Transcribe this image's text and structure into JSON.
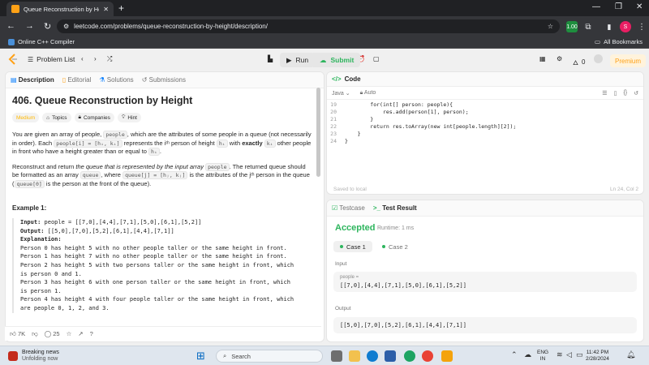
{
  "browser": {
    "tab_title": "Queue Reconstruction by Heigh",
    "url": "leetcode.com/problems/queue-reconstruction-by-height/description/",
    "bookmark_left": "Online C++ Compiler",
    "bookmark_right": "All Bookmarks",
    "ext_badge": "1.00",
    "profile_letter": "S"
  },
  "nav": {
    "problem_list": "Problem List",
    "run": "Run",
    "submit": "Submit",
    "streak": "0",
    "premium": "Premium"
  },
  "left_tabs": [
    "Description",
    "Editorial",
    "Solutions",
    "Submissions"
  ],
  "problem": {
    "title": "406. Queue Reconstruction by Height",
    "difficulty": "Medium",
    "chips": [
      "Topics",
      "Companies",
      "Hint"
    ],
    "p1_a": "You are given an array of people, ",
    "p1_code1": "people",
    "p1_b": ", which are the attributes of some people in a queue (not necessarily in order). Each ",
    "p1_code2": "people[i] = [hᵢ, kᵢ]",
    "p1_c": " represents the ",
    "p1_d": "iᵗʰ",
    "p1_e": " person of height ",
    "p1_code3": "hᵢ",
    "p1_f": " with ",
    "p1_g": "exactly",
    "p1_code4": "kᵢ",
    "p1_h": " other people in front who have a height greater than or equal to ",
    "p1_code5": "hᵢ",
    "p1_i": ".",
    "p2_a": "Reconstruct and return ",
    "p2_b": "the queue that is represented by the input array ",
    "p2_code1": "people",
    "p2_c": ". The returned queue should be formatted as an array ",
    "p2_code2": "queue",
    "p2_d": ", where ",
    "p2_code3": "queue[j] = [hⱼ, kⱼ]",
    "p2_e": " is the attributes of the ",
    "p2_f": "jᵗʰ",
    "p2_g": " person in the queue (",
    "p2_code4": "queue[0]",
    "p2_h": " is the person at the front of the queue).",
    "example_head": "Example 1:",
    "input_label": "Input:",
    "input_val": " people = [[7,0],[4,4],[7,1],[5,0],[6,1],[5,2]]",
    "output_label": "Output:",
    "output_val": " [[5,0],[7,0],[5,2],[6,1],[4,4],[7,1]]",
    "expl_label": "Explanation:",
    "expl_lines": [
      "Person 0 has height 5 with no other people taller or the same height in front.",
      "Person 1 has height 7 with no other people taller or the same height in front.",
      "Person 2 has height 5 with two persons taller or the same height in front, which",
      "is person 0 and 1.",
      "Person 3 has height 6 with one person taller or the same height in front, which",
      "is person 1.",
      "Person 4 has height 4 with four people taller or the same height in front, which",
      "are people 0, 1, 2, and 3."
    ]
  },
  "footer": {
    "likes": "7K",
    "comments": "25"
  },
  "code": {
    "header": "Code",
    "language": "Java",
    "mode": "Auto",
    "lines": [
      {
        "n": "19",
        "t": "        for(int[] person: people){"
      },
      {
        "n": "20",
        "t": "            res.add(person[1], person);"
      },
      {
        "n": "21",
        "t": "        }"
      },
      {
        "n": "22",
        "t": "        return res.toArray(new int[people.length][2]);"
      },
      {
        "n": "23",
        "t": "    }"
      },
      {
        "n": "24",
        "t": "}"
      }
    ],
    "saved": "Saved to local",
    "position": "Ln 24, Col 2"
  },
  "result": {
    "tabs": [
      "Testcase",
      "Test Result"
    ],
    "status": "Accepted",
    "runtime": "Runtime: 1 ms",
    "case1": "Case 1",
    "case2": "Case 2",
    "input_label": "Input",
    "input_var": "people =",
    "input_val": "[[7,0],[4,4],[7,1],[5,0],[6,1],[5,2]]",
    "output_label": "Output",
    "output_val": "[[5,0],[7,0],[5,2],[6,1],[4,4],[7,1]]"
  },
  "taskbar": {
    "news_title": "Breaking news",
    "news_sub": "Unfolding now",
    "news_badge": "1",
    "search": "Search",
    "lang1": "ENG",
    "lang2": "IN",
    "time": "11:42 PM",
    "date": "2/28/2024"
  },
  "colors": {
    "accepted": "#2db55d",
    "medium": "#ffb800",
    "premium": "#ffa116",
    "chrome_dark": "#202124"
  }
}
